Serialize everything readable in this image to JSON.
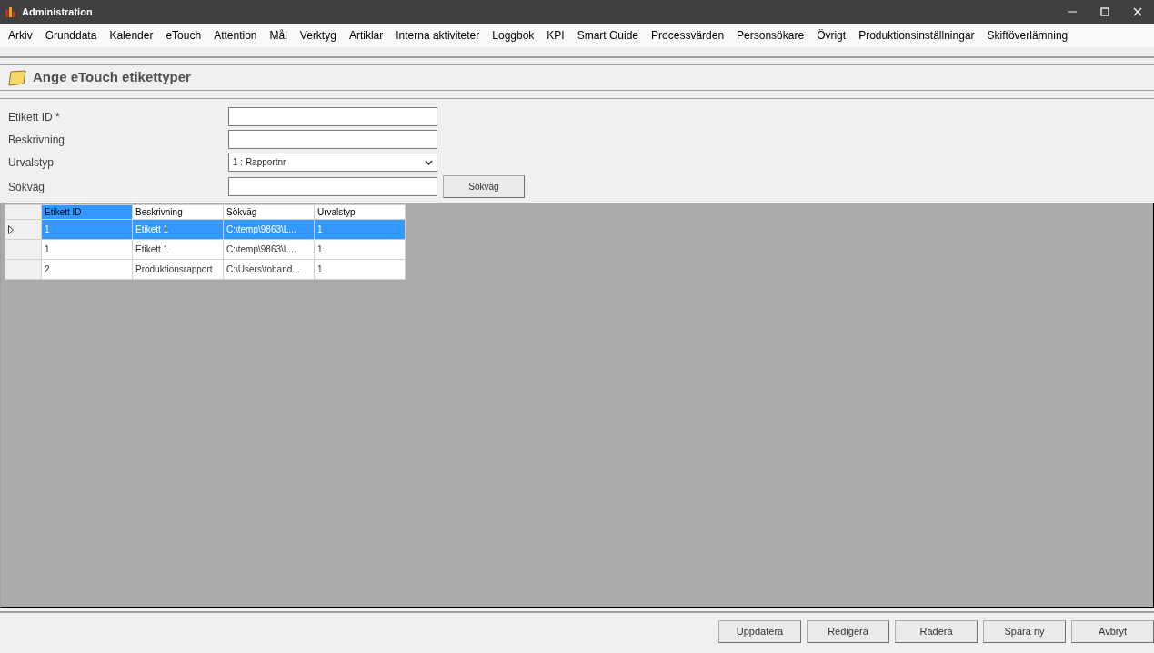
{
  "window": {
    "title": "Administration"
  },
  "menu": [
    "Arkiv",
    "Grunddata",
    "Kalender",
    "eTouch",
    "Attention",
    "Mål",
    "Verktyg",
    "Artiklar",
    "Interna aktiviteter",
    "Loggbok",
    "KPI",
    "Smart Guide",
    "Processvärden",
    "Personsökare",
    "Övrigt",
    "Produktionsinställningar",
    "Skiftöverlämning"
  ],
  "page_title": "Ange eTouch etikettyper",
  "form": [
    {
      "label": "Etikett ID *",
      "kind": "text"
    },
    {
      "label": "Beskrivning",
      "kind": "text"
    },
    {
      "label": "Urvalstyp",
      "kind": "select",
      "value": "1 : Rapportnr"
    },
    {
      "label": "Sökväg",
      "kind": "text",
      "button": "Sökväg"
    }
  ],
  "table": {
    "columns": [
      {
        "label": "Etikett ID",
        "selected": true
      },
      {
        "label": "Beskrivning",
        "selected": false
      },
      {
        "label": "Sökväg",
        "selected": false
      },
      {
        "label": "Urvalstyp",
        "selected": false
      }
    ],
    "rows": [
      {
        "cells": [
          "1",
          "Etikett 1",
          "C:\\temp\\9863\\L...",
          "1"
        ],
        "selected": true
      },
      {
        "cells": [
          "1",
          "Etikett 1",
          "C:\\temp\\9863\\L...",
          "1"
        ],
        "selected": false
      },
      {
        "cells": [
          "2",
          "Produktionsrapport",
          "C:\\Users\\toband...",
          "1"
        ],
        "selected": false
      }
    ]
  },
  "buttons": [
    "Uppdatera",
    "Redigera",
    "Radera",
    "Spara ny",
    "Avbryt"
  ]
}
